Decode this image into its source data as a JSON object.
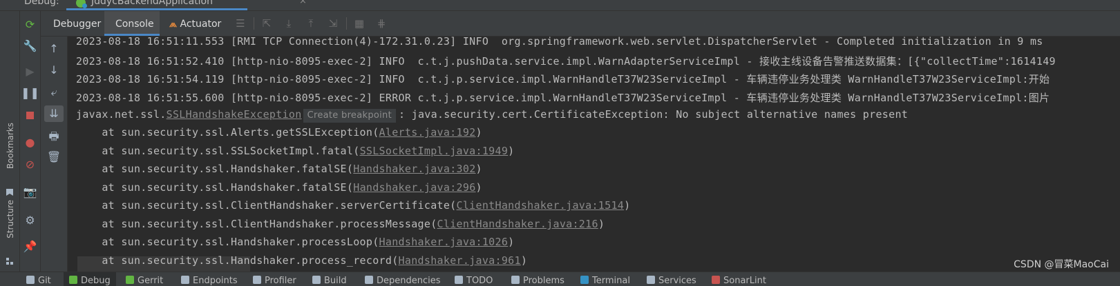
{
  "topbar": {
    "label": "Debug:",
    "run_config": "JddycBackendApplication",
    "close": "×"
  },
  "leftbar": {
    "bookmarks": "Bookmarks",
    "structure": "Structure"
  },
  "tabs": [
    {
      "label": "Debugger"
    },
    {
      "label": "Console"
    },
    {
      "label": "Actuator"
    }
  ],
  "console": {
    "lines": [
      "2023-08-18 16:51:11.553 [RMI TCP Connection(4)-172.31.0.23] INFO  org.springframework.web.servlet.DispatcherServlet - Completed initialization in 9 ms",
      "2023-08-18 16:51:52.410 [http-nio-8095-exec-2] INFO  c.t.j.pushData.service.impl.WarnAdapterServiceImpl - 接收主线设备告警推送数据集：[{\"collectTime\":1614149",
      "2023-08-18 16:51:54.119 [http-nio-8095-exec-2] INFO  c.t.j.p.service.impl.WarnHandleT37W23ServiceImpl - 车辆违停业务处理类 WarnHandleT37W23ServiceImpl:开始",
      "2023-08-18 16:51:55.600 [http-nio-8095-exec-2] ERROR c.t.j.p.service.impl.WarnHandleT37W23ServiceImpl - 车辆违停业务处理类 WarnHandleT37W23ServiceImpl:图片"
    ],
    "exception": {
      "prefix": "javax.net.ssl.",
      "class_link": "SSLHandshakeException",
      "hint": "Create breakpoint",
      "message": ": java.security.cert.CertificateException: No subject alternative names present"
    },
    "stack": [
      {
        "method": "    at sun.security.ssl.Alerts.getSSLException(",
        "link": "Alerts.java:192",
        "end": ")"
      },
      {
        "method": "    at sun.security.ssl.SSLSocketImpl.fatal(",
        "link": "SSLSocketImpl.java:1949",
        "end": ")"
      },
      {
        "method": "    at sun.security.ssl.Handshaker.fatalSE(",
        "link": "Handshaker.java:302",
        "end": ")"
      },
      {
        "method": "    at sun.security.ssl.Handshaker.fatalSE(",
        "link": "Handshaker.java:296",
        "end": ")"
      },
      {
        "method": "    at sun.security.ssl.ClientHandshaker.serverCertificate(",
        "link": "ClientHandshaker.java:1514",
        "end": ")"
      },
      {
        "method": "    at sun.security.ssl.ClientHandshaker.processMessage(",
        "link": "ClientHandshaker.java:216",
        "end": ")"
      },
      {
        "method": "    at sun.security.ssl.Handshaker.processLoop(",
        "link": "Handshaker.java:1026",
        "end": ")"
      },
      {
        "method": "    at sun.security.ssl.Handshaker.process_record(",
        "link": "Handshaker.java:961",
        "end": ")"
      }
    ]
  },
  "statusbar": {
    "items": [
      {
        "label": "Git",
        "color": "#a9b7c6"
      },
      {
        "label": "Debug",
        "color": "#62b543"
      },
      {
        "label": "Gerrit",
        "color": "#62b543"
      },
      {
        "label": "Endpoints",
        "color": "#a9b7c6"
      },
      {
        "label": "Profiler",
        "color": "#a9b7c6"
      },
      {
        "label": "Build",
        "color": "#a9b7c6"
      },
      {
        "label": "Dependencies",
        "color": "#a9b7c6"
      },
      {
        "label": "TODO",
        "color": "#a9b7c6"
      },
      {
        "label": "Problems",
        "color": "#a9b7c6"
      },
      {
        "label": "Terminal",
        "color": "#3592c4"
      },
      {
        "label": "Services",
        "color": "#a9b7c6"
      },
      {
        "label": "SonarLint",
        "color": "#c75450"
      }
    ]
  },
  "watermark": "CSDN @冒菜MaoCai",
  "colors": {
    "accent": "#4a88c7",
    "rerun": "#62b543",
    "stop": "#c75450",
    "panel": "#3c3f41",
    "editor": "#2b2b2b"
  }
}
